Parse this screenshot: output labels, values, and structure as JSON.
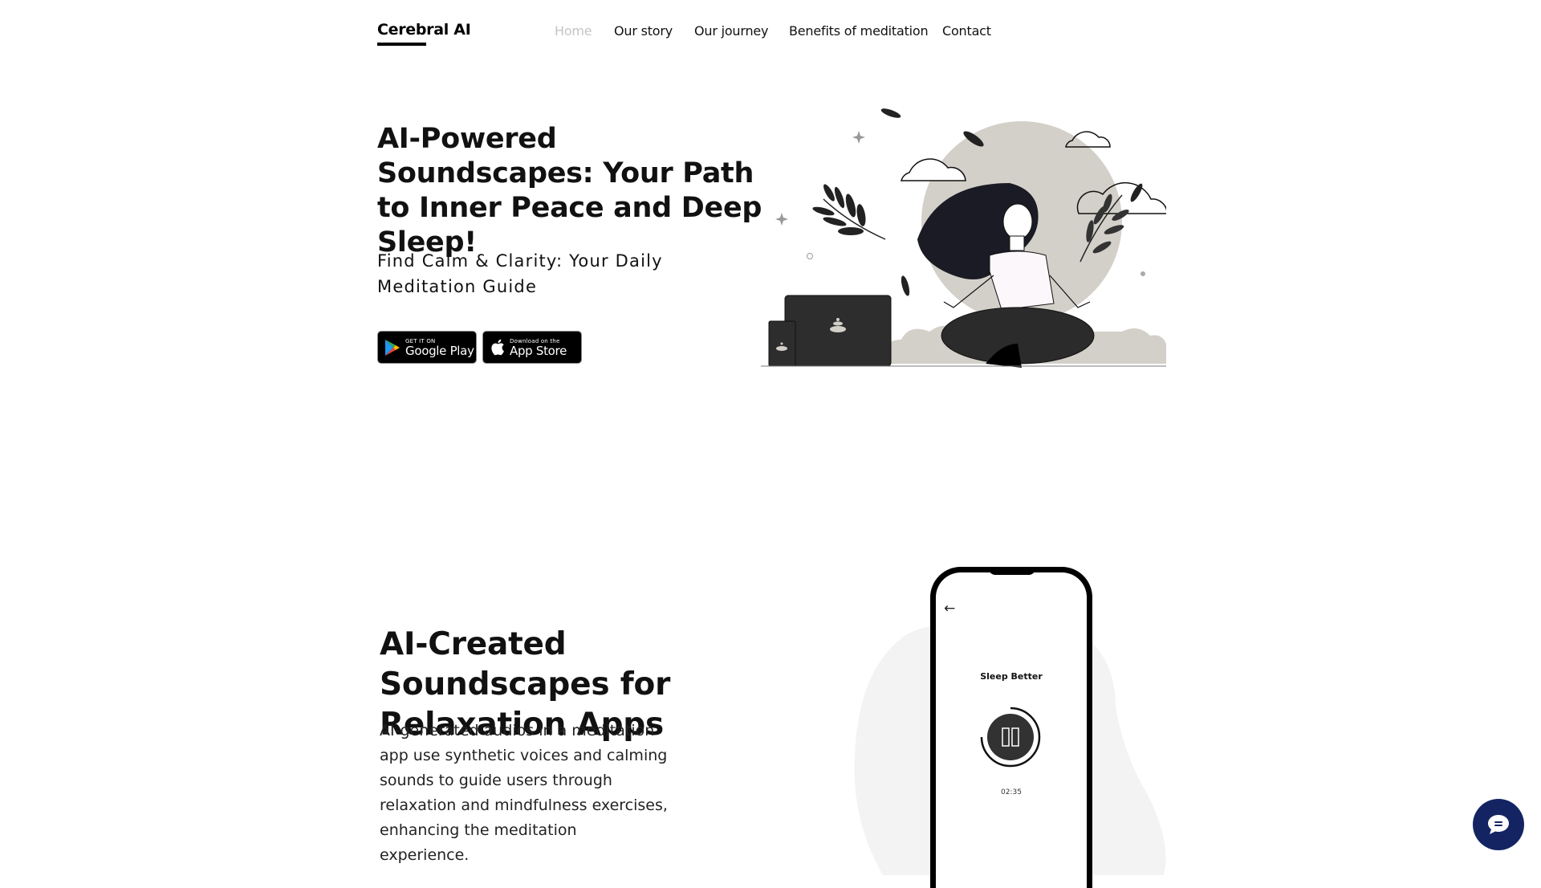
{
  "header": {
    "logo": "Cerebral AI",
    "nav": [
      {
        "label": "Home",
        "active": true
      },
      {
        "label": "Our story",
        "active": false
      },
      {
        "label": "Our journey",
        "active": false
      },
      {
        "label": "Benefits of meditation",
        "active": false
      },
      {
        "label": "Contact",
        "active": false
      }
    ]
  },
  "hero": {
    "title": "AI-Powered Soundscapes: Your Path to Inner Peace and Deep Sleep!",
    "subtitle": "Find Calm & Clarity: Your Daily Meditation Guide",
    "badges": {
      "google_play": {
        "small": "GET IT ON",
        "big": "Google Play",
        "icon": "google-play-icon"
      },
      "app_store": {
        "small": "Download on the",
        "big": "App Store",
        "icon": "apple-icon"
      }
    },
    "illustration": "meditating-woman-illustration"
  },
  "section2": {
    "title": "AI-Created Soundscapes for Relaxation Apps",
    "body": "AI-generated audios in a meditation app use synthetic voices and calming sounds to guide users through relaxation and mindfulness exercises, enhancing the meditation experience.",
    "phone": {
      "back_icon": "←",
      "screen_title": "Sleep Better",
      "player_state": "playing",
      "time": "02:35"
    }
  },
  "chat": {
    "icon": "chat-bubble-icon"
  },
  "colors": {
    "text": "#111111",
    "nav_active": "#c4c4c4",
    "chat_button": "#142463",
    "illustration_circle": "#d3d0c9",
    "blob": "#f2f3f2"
  }
}
